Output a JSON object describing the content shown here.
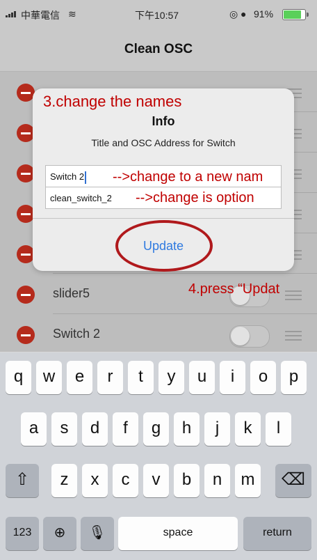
{
  "status_bar": {
    "carrier": "中華電信",
    "time": "下午10:57",
    "battery": "91%",
    "battery_level": 0.91
  },
  "nav": {
    "title": "Clean OSC"
  },
  "list": {
    "rows": [
      {
        "label": ""
      },
      {
        "label": ""
      },
      {
        "label": ""
      },
      {
        "label": ""
      },
      {
        "label": ""
      },
      {
        "label": "slider5"
      },
      {
        "label": "Switch 2"
      }
    ]
  },
  "alert": {
    "title": "Info",
    "message": "Title and OSC Address for Switch",
    "field_title": "Switch 2",
    "field_address": "clean_switch_2",
    "update_label": "Update"
  },
  "annotations": {
    "step3": "3.change the names",
    "change_name": "-->change to a new nam",
    "change_optional": "-->change is option",
    "step4": "4.press “Updat"
  },
  "keyboard": {
    "row1": [
      "q",
      "w",
      "e",
      "r",
      "t",
      "y",
      "u",
      "i",
      "o",
      "p"
    ],
    "row2": [
      "a",
      "s",
      "d",
      "f",
      "g",
      "h",
      "j",
      "k",
      "l"
    ],
    "row3": [
      "z",
      "x",
      "c",
      "v",
      "b",
      "n",
      "m"
    ],
    "numbers": "123",
    "space": "space",
    "return": "return"
  },
  "colors": {
    "accent": "#2f7ae0",
    "delete": "#b52b1c",
    "annotation": "#c00000"
  }
}
